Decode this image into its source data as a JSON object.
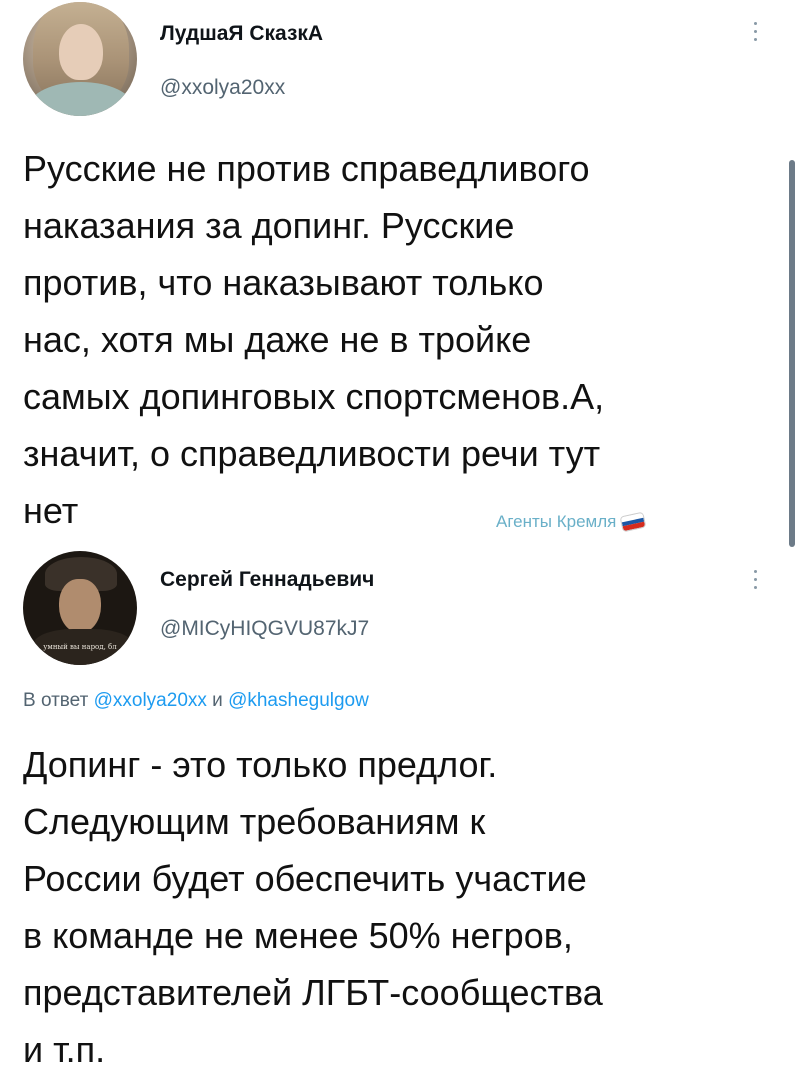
{
  "tweets": [
    {
      "author_name": "ЛудшаЯ СказкА",
      "author_handle": "@xxolya20xx",
      "text": "Русские не против справедливого\nнаказания за допинг. Русские\nпротив, что наказывают только\nнас,  хотя мы даже не в тройке\nсамых допинговых спортсменов.А,\nзначит, о справедливости речи тут\nнет"
    },
    {
      "author_name": "Сергей Геннадьевич",
      "author_handle": "@MICyHIQGVU87kJ7",
      "avatar_caption": "умный вы народ, бл",
      "reply_prefix": "В ответ",
      "reply_user_1": "@xxolya20xx",
      "reply_joiner": "и",
      "reply_user_2": "@khashegulgow",
      "text": "Допинг - это только предлог.\nСледующим требованиям к\nРоссии будет обеспечить участие\nв команде не менее 50% негров,\nпредставителей ЛГБТ-сообщества\nи т.п."
    }
  ],
  "watermark": {
    "text": "Агенты Кремля",
    "flag_colors": [
      "#ffffff",
      "#1c57a5",
      "#d52b1e"
    ]
  },
  "icons": {
    "more": "more-vertical-icon",
    "flag": "russian-flag-icon"
  },
  "colors": {
    "text": "#111111",
    "secondary": "#536471",
    "link": "#1d9bf0",
    "watermark": "#6ab0c8"
  }
}
